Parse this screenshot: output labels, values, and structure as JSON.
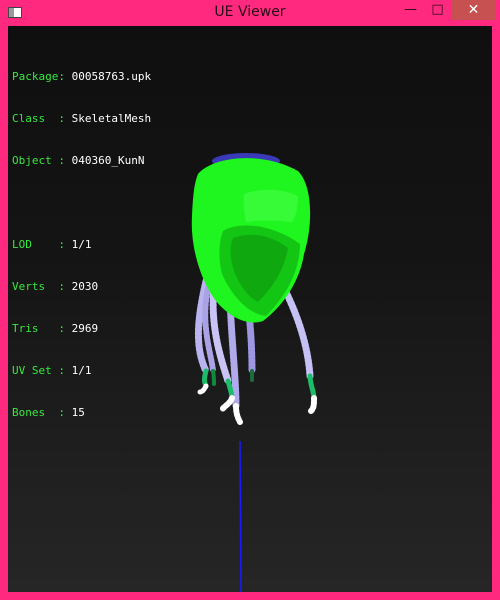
{
  "window": {
    "title": "UE Viewer",
    "controls": {
      "minimize": "—",
      "maximize": "□",
      "close": "✕"
    }
  },
  "info": {
    "package": {
      "label": "Package:",
      "value": "00058763.upk"
    },
    "class": {
      "label": "Class  :",
      "value": "SkeletalMesh"
    },
    "object": {
      "label": "Object :",
      "value": "040360_KunN"
    },
    "lod": {
      "label": "LOD    :",
      "value": "1/1"
    },
    "verts": {
      "label": "Verts  :",
      "value": "2030"
    },
    "tris": {
      "label": "Tris   :",
      "value": "2969"
    },
    "uvset": {
      "label": "UV Set :",
      "value": "1/1"
    },
    "bones": {
      "label": "Bones  :",
      "value": "15"
    }
  },
  "colors": {
    "border": "#ff2a7f",
    "info_label": "#37e83f",
    "info_value": "#ffffff",
    "mesh_green": "#1ff51f",
    "cord": "#b9b3ef",
    "axis": "#1a1aff"
  }
}
